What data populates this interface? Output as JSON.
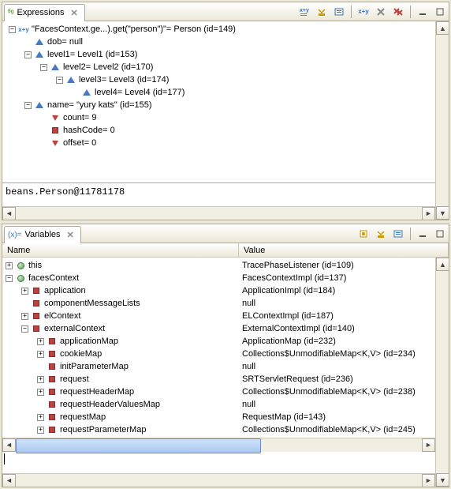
{
  "expressions": {
    "tab_label": "Expressions",
    "toolbar": {
      "show_type_names": "x+y with tree",
      "collapse_all": "collapse",
      "expand": "expand",
      "add_watch": "x+y",
      "remove": "remove",
      "remove_all": "remove all",
      "minimize": "minimize",
      "maximize": "maximize"
    },
    "rows": [
      {
        "depth": 0,
        "twist": "-",
        "icon": "xy",
        "text": "\"FacesContext.ge...).get(\"person\")\"= Person  (id=149)"
      },
      {
        "depth": 1,
        "twist": "",
        "icon": "tri",
        "text": "dob= null"
      },
      {
        "depth": 1,
        "twist": "-",
        "icon": "tri",
        "text": "level1= Level1  (id=153)"
      },
      {
        "depth": 2,
        "twist": "-",
        "icon": "tri",
        "text": "level2= Level2  (id=170)"
      },
      {
        "depth": 3,
        "twist": "-",
        "icon": "tri",
        "text": "level3= Level3  (id=174)"
      },
      {
        "depth": 4,
        "twist": "",
        "icon": "tri",
        "text": "level4= Level4  (id=177)"
      },
      {
        "depth": 1,
        "twist": "-",
        "icon": "tri",
        "text": "name= \"yury kats\"  (id=155)"
      },
      {
        "depth": 2,
        "twist": "",
        "icon": "redtri",
        "text": "count= 9"
      },
      {
        "depth": 2,
        "twist": "",
        "icon": "sq",
        "text": "hashCode= 0"
      },
      {
        "depth": 2,
        "twist": "",
        "icon": "redtri",
        "text": "offset= 0"
      }
    ],
    "detail": "beans.Person@11781178"
  },
  "variables": {
    "tab_label": "Variables",
    "toolbar": {
      "show_logical": "logical",
      "collapse_all": "collapse",
      "expand": "expand",
      "minimize": "minimize",
      "maximize": "maximize"
    },
    "columns": {
      "name": "Name",
      "value": "Value"
    },
    "rows": [
      {
        "depth": 0,
        "twist": "+",
        "icon": "circ",
        "name": "this",
        "value": "TracePhaseListener  (id=109)"
      },
      {
        "depth": 0,
        "twist": "-",
        "icon": "circ",
        "name": "facesContext",
        "value": "FacesContextImpl  (id=137)"
      },
      {
        "depth": 1,
        "twist": "+",
        "icon": "sq",
        "name": "application",
        "value": "ApplicationImpl  (id=184)"
      },
      {
        "depth": 1,
        "twist": "",
        "icon": "sq",
        "name": "componentMessageLists",
        "value": "null"
      },
      {
        "depth": 1,
        "twist": "+",
        "icon": "sq",
        "name": "elContext",
        "value": "ELContextImpl  (id=187)"
      },
      {
        "depth": 1,
        "twist": "-",
        "icon": "sq",
        "name": "externalContext",
        "value": "ExternalContextImpl  (id=140)"
      },
      {
        "depth": 2,
        "twist": "+",
        "icon": "sq",
        "name": "applicationMap",
        "value": "ApplicationMap  (id=232)"
      },
      {
        "depth": 2,
        "twist": "+",
        "icon": "sq",
        "name": "cookieMap",
        "value": "Collections$UnmodifiableMap<K,V>  (id=234)"
      },
      {
        "depth": 2,
        "twist": "",
        "icon": "sq",
        "name": "initParameterMap",
        "value": "null"
      },
      {
        "depth": 2,
        "twist": "+",
        "icon": "sq",
        "name": "request",
        "value": "SRTServletRequest  (id=236)"
      },
      {
        "depth": 2,
        "twist": "+",
        "icon": "sq",
        "name": "requestHeaderMap",
        "value": "Collections$UnmodifiableMap<K,V>  (id=238)"
      },
      {
        "depth": 2,
        "twist": "",
        "icon": "sq",
        "name": "requestHeaderValuesMap",
        "value": "null"
      },
      {
        "depth": 2,
        "twist": "+",
        "icon": "sq",
        "name": "requestMap",
        "value": "RequestMap  (id=143)"
      },
      {
        "depth": 2,
        "twist": "+",
        "icon": "sq",
        "name": "requestParameterMap",
        "value": "Collections$UnmodifiableMap<K,V>  (id=245)"
      }
    ]
  }
}
